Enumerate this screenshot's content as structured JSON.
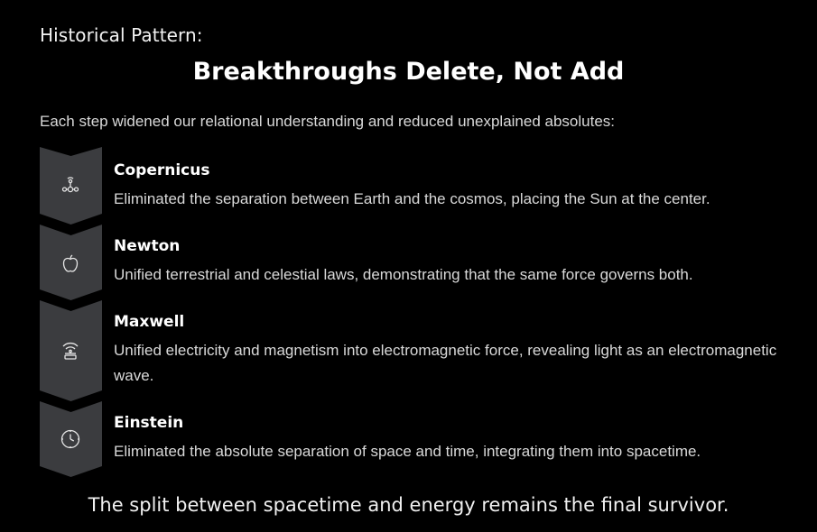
{
  "header": {
    "kicker": "Historical Pattern:",
    "title": "Breakthroughs Delete, Not Add",
    "intro": "Each step widened our relational understanding and reduced unexplained absolutes:"
  },
  "steps": [
    {
      "name": "Copernicus",
      "description": "Eliminated the separation between Earth and the cosmos, placing the Sun at the center.",
      "icon": "solar-system-icon"
    },
    {
      "name": "Newton",
      "description": "Unified terrestrial and celestial laws, demonstrating that the same force governs both.",
      "icon": "apple-icon"
    },
    {
      "name": "Maxwell",
      "description": "Unified electricity and magnetism into electromagnetic force, revealing light as an electromagnetic wave.",
      "icon": "wave-signal-icon"
    },
    {
      "name": "Einstein",
      "description": "Eliminated the absolute separation of space and time, integrating them into spacetime.",
      "icon": "clock-icon"
    }
  ],
  "footer": {
    "text": "The split between spacetime and energy remains the final survivor."
  },
  "colors": {
    "background": "#000000",
    "chevron": "#3b3c3f",
    "text": "#ffffff",
    "muted_text": "#d9d9d9"
  }
}
